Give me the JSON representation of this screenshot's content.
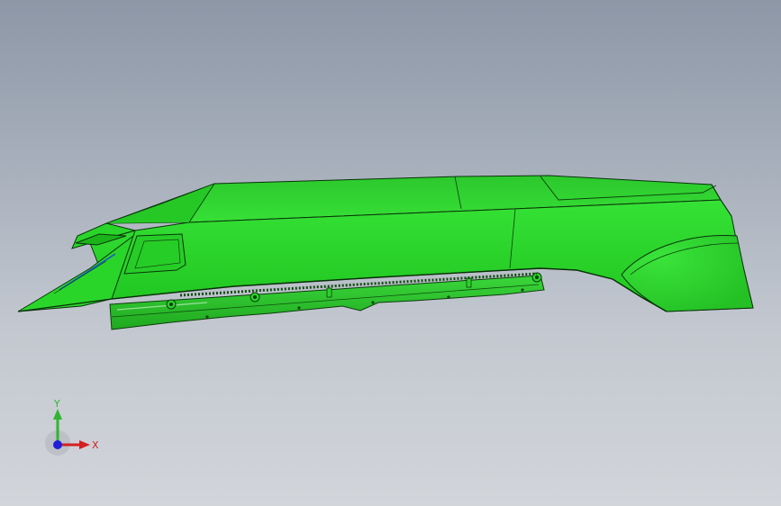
{
  "triad": {
    "y_label": "Y",
    "x_label": "X",
    "colors": {
      "y_axis": "#2fb52f",
      "x_axis": "#d42020",
      "z_axis": "#2020d8"
    }
  },
  "model": {
    "part_color": "#2fdc2f",
    "edge_color": "#0b3a0b",
    "icon": "3d-part-model"
  },
  "background": {
    "top": "#8d97a6",
    "bottom": "#d2d5da"
  }
}
